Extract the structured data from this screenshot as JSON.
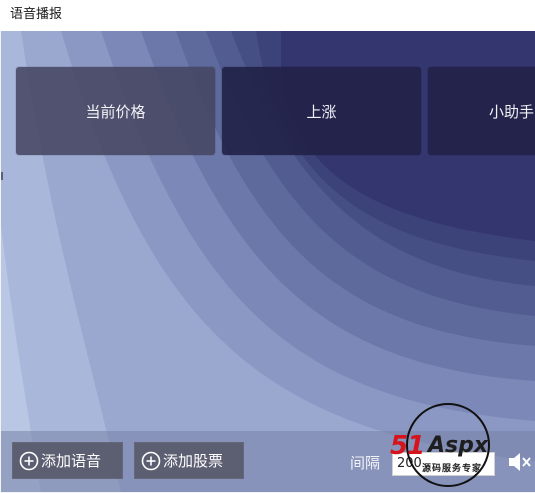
{
  "window": {
    "title": "语音播报"
  },
  "cards": [
    {
      "label": "当前价格"
    },
    {
      "label": "上涨"
    },
    {
      "label": "小助手"
    }
  ],
  "bottombar": {
    "add_voice_label": "添加语音",
    "add_stock_label": "添加股票",
    "interval_label": "间隔",
    "interval_value": "200",
    "speaker_icon": "speaker-muted-icon"
  },
  "watermark": {
    "brand_number": "51",
    "brand_name": "Aspx",
    "tagline": "源码服务专家"
  },
  "colors": {
    "background_light": "#b7c5e3",
    "background_dark": "#33336f",
    "card_dark": "#212148",
    "card_light": "#46465f",
    "button": "#5c5f72",
    "watermark_red": "#d6141c"
  }
}
